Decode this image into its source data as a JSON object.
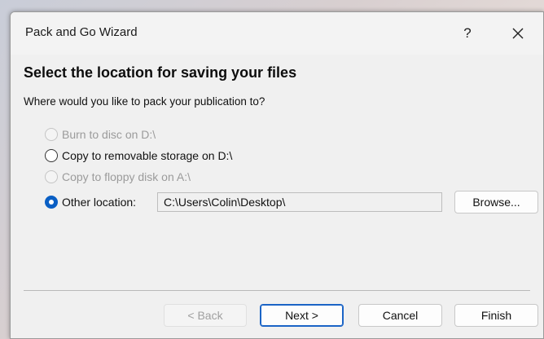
{
  "window": {
    "title": "Pack and Go Wizard",
    "help_label": "?"
  },
  "page": {
    "heading": "Select the location for saving your files",
    "question": "Where would you like to pack your publication to?"
  },
  "options": [
    {
      "label": "Burn to disc on D:\\",
      "enabled": false,
      "selected": false
    },
    {
      "label": "Copy to removable storage on D:\\",
      "enabled": true,
      "selected": false
    },
    {
      "label": "Copy to floppy disk on A:\\",
      "enabled": false,
      "selected": false
    },
    {
      "label": "Other location:",
      "enabled": true,
      "selected": true
    }
  ],
  "location": {
    "value": "C:\\Users\\Colin\\Desktop\\"
  },
  "buttons": {
    "browse": "Browse...",
    "back": "< Back",
    "next": "Next >",
    "cancel": "Cancel",
    "finish": "Finish"
  },
  "colors": {
    "accent": "#0a5fc4",
    "dialog_bg": "#f0f0f0",
    "disabled_text": "#9b9b9b"
  },
  "icons": {
    "close": "close-icon"
  }
}
